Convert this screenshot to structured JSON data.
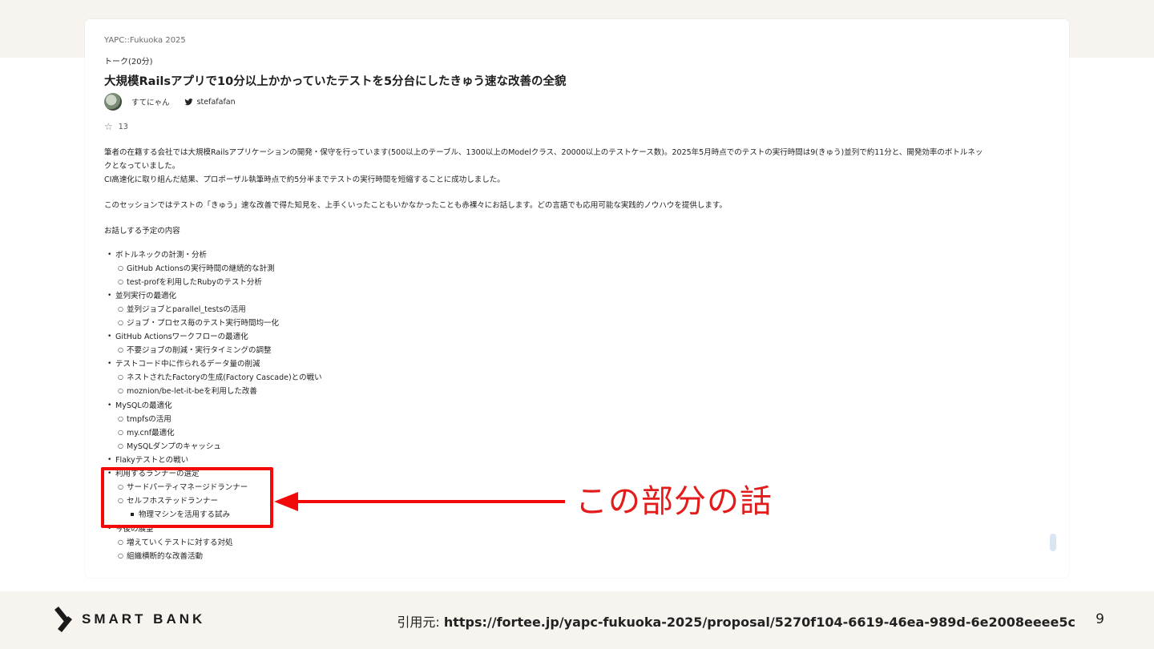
{
  "talk": {
    "event": "YAPC::Fukuoka 2025",
    "kind": "トーク(20分)",
    "title": "大規模Railsアプリで10分以上かかっていたテストを5分台にしたきゅう速な改善の全貌",
    "author": "すてにゃん",
    "twitter": "stefafafan",
    "stars": "13",
    "description": [
      "筆者の在籍する会社では大規模Railsアプリケーションの開発・保守を行っています(500以上のテーブル、1300以上のModelクラス、20000以上のテストケース数)。2025年5月時点でのテストの実行時間は9(きゅう)並列で約11分と、開発効率のボトルネッ",
      "クとなっていました。",
      "CI高速化に取り組んだ結果、プロポーザル執筆時点で約5分半までテストの実行時間を短縮することに成功しました。",
      "このセッションではテストの「きゅう」速な改善で得た知見を、上手くいったこともいかなかったことも赤裸々にお話します。どの言語でも応用可能な実践的ノウハウを提供します。",
      "お話しする予定の内容"
    ],
    "outline": [
      "ボトルネックの計測・分析",
      "GitHub Actionsの実行時間の継続的な計測",
      "test-profを利用したRubyのテスト分析",
      "並列実行の最適化",
      "並列ジョブとparallel_testsの活用",
      "ジョブ・プロセス毎のテスト実行時間均一化",
      "GitHub Actionsワークフローの最適化",
      "不要ジョブの削減・実行タイミングの調整",
      "テストコード中に作られるデータ量の削減",
      "ネストされたFactoryの生成(Factory Cascade)との戦い",
      "moznion/be-let-it-beを利用した改善",
      "MySQLの最適化",
      "tmpfsの活用",
      "my.cnf最適化",
      "MySQLダンプのキャッシュ",
      "Flakyテストとの戦い",
      "利用するランナーの選定",
      "サードパーティマネージドランナー",
      "セルフホステッドランナー",
      "物理マシンを活用する試み",
      "今後の展望",
      "増えていくテストに対する対処",
      "組織横断的な改善活動"
    ]
  },
  "callout": "この部分の話",
  "colors": {
    "accent": "#e31b1b",
    "band": "#f7f4ef"
  },
  "footer": {
    "logo": "SMART BANK",
    "source_prefix": "引用元: ",
    "source_url": "https://fortee.jp/yapc-fukuoka-2025/proposal/5270f104-6619-46ea-989d-6e2008eeee5c",
    "page": "9"
  }
}
